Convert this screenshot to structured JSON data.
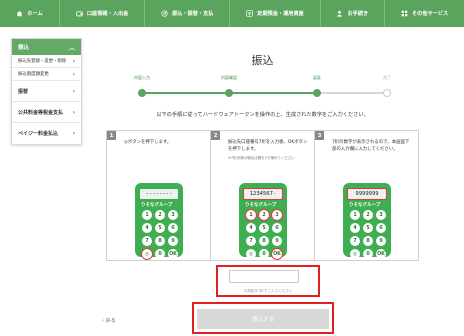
{
  "nav": {
    "items": [
      {
        "label": "ホーム",
        "icon": "home-icon"
      },
      {
        "label": "口座情報・入出金",
        "icon": "wallet-icon"
      },
      {
        "label": "振込・振替・支払",
        "icon": "transfer-icon"
      },
      {
        "label": "定期預金・運用資産",
        "icon": "yen-icon"
      },
      {
        "label": "お手続き",
        "icon": "person-icon"
      },
      {
        "label": "その他サービス",
        "icon": "grid-icon"
      }
    ]
  },
  "sidebar": {
    "header": "振込",
    "sub_items": [
      "振込先登録・変更・削除",
      "振込限度額変更"
    ],
    "main_items": [
      "振替",
      "公共料金等税金支払",
      "ペイジー料金払込"
    ]
  },
  "main": {
    "title": "振込",
    "steps": [
      "内容入力",
      "内容確認",
      "認証",
      "完了"
    ],
    "instruction": "以下の手順に従ってハードウェアトークンを操作の上、生成された数字をご入力ください。",
    "boxes": [
      {
        "num": "1",
        "text": "◎ボタンを押下します。",
        "note": "",
        "screen": "--------"
      },
      {
        "num": "2",
        "text": "振込先口座番号7桁を入力後、OKボタンを押下します。",
        "note": "※7桁未満の場合は頭を0で埋めてください",
        "screen": "1234567-"
      },
      {
        "num": "3",
        "text": "7桁の数字が表示されるので、本画面下部の入力欄に入力してください。",
        "note": "",
        "screen": "9999999"
      }
    ],
    "token_brand": "りそなグループ",
    "keypad": [
      "1",
      "2",
      "3",
      "4",
      "5",
      "6",
      "7",
      "8",
      "9",
      "◎",
      "0",
      "OK"
    ],
    "input_placeholder": "",
    "input_hint": "半角数字7桁でご入力ください",
    "back_label": "戻る",
    "submit_label": "振込する"
  },
  "colors": {
    "nav_green": "#5aa45d",
    "token_green": "#3fae52",
    "highlight_red": "#e02020"
  }
}
